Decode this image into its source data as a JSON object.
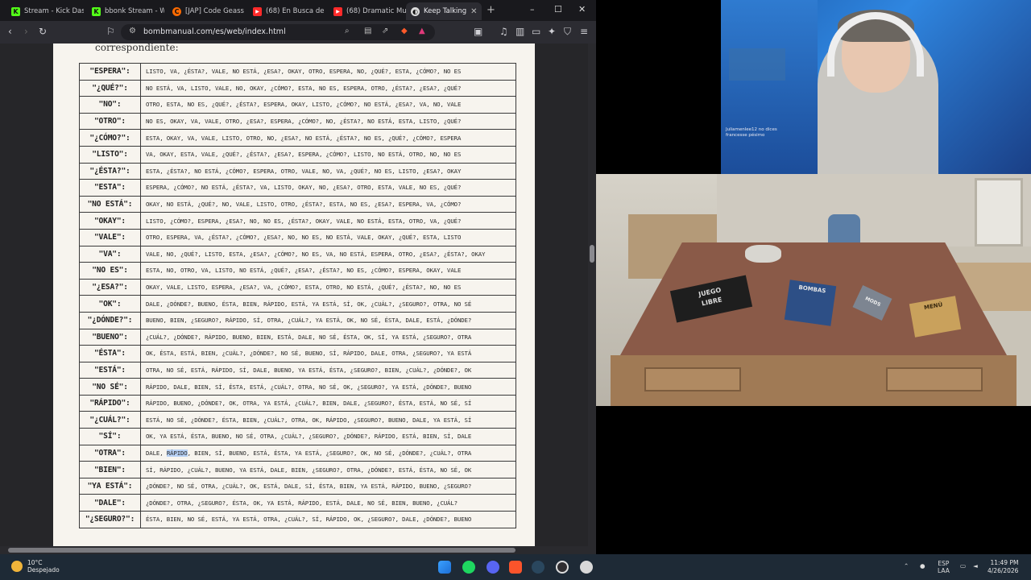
{
  "browser": {
    "tabs": [
      {
        "title": "Stream - Kick Dash",
        "icon_color": "#53fc18",
        "icon": "K"
      },
      {
        "title": "bbonk Stream - W",
        "icon_color": "#53fc18",
        "icon": "K"
      },
      {
        "title": "[JAP] Code Geass",
        "icon_color": "#ff6a00",
        "icon": "C"
      },
      {
        "title": "(68) En Busca de l",
        "icon_color": "#ff2a2a",
        "icon": "▶"
      },
      {
        "title": "(68) Dramatic Mu",
        "icon_color": "#ff2a2a",
        "icon": "▶"
      },
      {
        "title": "Keep Talking",
        "icon_color": "#dcdcdc",
        "icon": "◐"
      }
    ],
    "url": "bombmanual.com/es/web/index.html",
    "new_tab": "+",
    "window_controls": [
      "–",
      "☐",
      "✕"
    ]
  },
  "manual": {
    "intro": "correspondiente:",
    "rows": [
      {
        "key": "\"ESPERA\":",
        "list": "LISTO, VA, ¿ÉSTA?, VALE, NO ESTÁ, ¿ESA?, OKAY, OTRO, ESPERA, NO, ¿QUÉ?, ESTA, ¿CÓMO?, NO ES"
      },
      {
        "key": "\"¿QUÉ?\":",
        "list": "NO ESTÁ, VA, LISTO, VALE, NO, OKAY, ¿CÓMO?, ESTA, NO ES, ESPERA, OTRO, ¿ÉSTA?, ¿ESA?, ¿QUÉ?"
      },
      {
        "key": "\"NO\":",
        "list": "OTRO, ESTA, NO ES, ¿QUÉ?, ¿ÉSTA?, ESPERA, OKAY, LISTO, ¿CÓMO?, NO ESTÁ, ¿ESA?, VA, NO, VALE"
      },
      {
        "key": "\"OTRO\":",
        "list": "NO ES, OKAY, VA, VALE, OTRO, ¿ESA?, ESPERA, ¿CÓMO?, NO, ¿ÉSTA?, NO ESTÁ, ESTA, LISTO, ¿QUÉ?"
      },
      {
        "key": "\"¿CÓMO?\":",
        "list": "ESTA, OKAY, VA, VALE, LISTO, OTRO, NO, ¿ESA?, NO ESTÁ, ¿ÉSTA?, NO ES, ¿QUÉ?, ¿CÓMO?, ESPERA"
      },
      {
        "key": "\"LISTO\":",
        "list": "VA, OKAY, ESTA, VALE, ¿QUÉ?, ¿ÉSTA?, ¿ESA?, ESPERA, ¿CÓMO?, LISTO, NO ESTÁ, OTRO, NO, NO ES"
      },
      {
        "key": "\"¿ÉSTA?\":",
        "list": "ESTA, ¿ÉSTA?, NO ESTÁ, ¿CÓMO?, ESPERA, OTRO, VALE, NO, VA, ¿QUÉ?, NO ES, LISTO, ¿ESA?, OKAY"
      },
      {
        "key": "\"ESTA\":",
        "list": "ESPERA, ¿CÓMO?, NO ESTÁ, ¿ÉSTA?, VA, LISTO, OKAY, NO, ¿ESA?, OTRO, ESTA, VALE, NO ES, ¿QUÉ?"
      },
      {
        "key": "\"NO ESTÁ\":",
        "list": "OKAY, NO ESTÁ, ¿QUÉ?, NO, VALE, LISTO, OTRO, ¿ÉSTA?, ESTA, NO ES, ¿ESA?, ESPERA, VA, ¿CÓMO?"
      },
      {
        "key": "\"OKAY\":",
        "list": "LISTO, ¿CÓMO?, ESPERA, ¿ESA?, NO, NO ES, ¿ÉSTA?, OKAY, VALE, NO ESTÁ, ESTA, OTRO, VA, ¿QUÉ?"
      },
      {
        "key": "\"VALE\":",
        "list": "OTRO, ESPERA, VA, ¿ÉSTA?, ¿CÓMO?, ¿ESA?, NO, NO ES, NO ESTÁ, VALE, OKAY, ¿QUÉ?, ESTA, LISTO"
      },
      {
        "key": "\"VA\":",
        "list": "VALE, NO, ¿QUÉ?, LISTO, ESTA, ¿ESA?, ¿CÓMO?, NO ES, VA, NO ESTÁ, ESPERA, OTRO, ¿ESA?, ¿ÉSTA?, OKAY"
      },
      {
        "key": "\"NO ES\":",
        "list": "ESTA, NO, OTRO, VA, LISTO, NO ESTÁ, ¿QUÉ?, ¿ESA?, ¿ÉSTA?, NO ES, ¿CÓMO?, ESPERA, OKAY, VALE"
      },
      {
        "key": "\"¿ESA?\":",
        "list": "OKAY, VALE, LISTO, ESPERA, ¿ESA?, VA, ¿CÓMO?, ESTA, OTRO, NO ESTÁ, ¿QUÉ?, ¿ÉSTA?, NO, NO ES"
      },
      {
        "key": "\"OK\":",
        "list": "DALE, ¿DÓNDE?, BUENO, ÉSTA, BIEN, RÁPIDO, ESTÁ, YA ESTÁ, SÍ, OK, ¿CUÁL?, ¿SEGURO?, OTRA, NO SÉ"
      },
      {
        "key": "\"¿DÓNDE?\":",
        "list": "BUENO, BIEN, ¿SEGURO?, RÁPIDO, SÍ, OTRA, ¿CUÁL?, YA ESTÁ, OK, NO SÉ, ÉSTA, DALE, ESTÁ, ¿DÓNDE?"
      },
      {
        "key": "\"BUENO\":",
        "list": "¿CUÁL?, ¿DÓNDE?, RÁPIDO, BUENO, BIEN, ESTÁ, DALE, NO SÉ, ÉSTA, OK, SÍ, YA ESTÁ, ¿SEGURO?, OTRA"
      },
      {
        "key": "\"ÉSTA\":",
        "list": "OK, ÉSTA, ESTÁ, BIEN, ¿CUÁL?, ¿DÓNDE?, NO SÉ, BUENO, SÍ, RÁPIDO, DALE, OTRA, ¿SEGURO?, YA ESTÁ"
      },
      {
        "key": "\"ESTÁ\":",
        "list": "OTRA, NO SÉ, ESTÁ, RÁPIDO, SÍ, DALE, BUENO, YA ESTÁ, ÉSTA, ¿SEGURO?, BIEN, ¿CUÁL?, ¿DÓNDE?, OK"
      },
      {
        "key": "\"NO SÉ\":",
        "list": "RÁPIDO, DALE, BIEN, SÍ, ÉSTA, ESTÁ, ¿CUÁL?, OTRA, NO SÉ, OK, ¿SEGURO?, YA ESTÁ, ¿DÓNDE?, BUENO"
      },
      {
        "key": "\"RÁPIDO\":",
        "list": "RÁPIDO, BUENO, ¿DÓNDE?, OK, OTRA, YA ESTÁ, ¿CUÁL?, BIEN, DALE, ¿SEGURO?, ÉSTA, ESTÁ, NO SÉ, SÍ"
      },
      {
        "key": "\"¿CUÁL?\":",
        "list": "ESTÁ, NO SÉ, ¿DÓNDE?, ÉSTA, BIEN, ¿CUÁL?, OTRA, OK, RÁPIDO, ¿SEGURO?, BUENO, DALE, YA ESTÁ, SÍ"
      },
      {
        "key": "\"SÍ\":",
        "list": "OK, YA ESTÁ, ÉSTA, BUENO, NO SÉ, OTRA, ¿CUÁL?, ¿SEGURO?, ¿DÓNDE?, RÁPIDO, ESTÁ, BIEN, SÍ, DALE"
      },
      {
        "key": "\"OTRA\":",
        "list_before": "DALE, ",
        "list_highlight": "RÁPIDO",
        "list_after": ", BIEN, SÍ, BUENO, ESTÁ, ÉSTA, YA ESTÁ, ¿SEGURO?, OK, NO SÉ, ¿DÓNDE?, ¿CUÁL?, OTRA"
      },
      {
        "key": "\"BIEN\":",
        "list": "SÍ, RÁPIDO, ¿CUÁL?, BUENO, YA ESTÁ, DALE, BIEN, ¿SEGURO?, OTRA, ¿DÓNDE?, ESTÁ, ÉSTA, NO SÉ, OK"
      },
      {
        "key": "\"YA ESTÁ\":",
        "list": "¿DÓNDE?, NO SÉ, OTRA, ¿CUÁL?, OK, ESTÁ, DALE, SÍ, ÉSTA, BIEN, YA ESTÁ, RÁPIDO, BUENO, ¿SEGURO?"
      },
      {
        "key": "\"DALE\":",
        "list": "¿DÓNDE?, OTRA, ¿SEGURO?, ÉSTA, OK, YA ESTÁ, RÁPIDO, ESTÁ, DALE, NO SÉ, BIEN, BUENO, ¿CUÁL?"
      },
      {
        "key": "\"¿SEGURO?\":",
        "list": "ÉSTA, BIEN, NO SÉ, ESTÁ, YA ESTÁ, OTRA, ¿CUÁL?, SÍ, RÁPIDO, OK, ¿SEGURO?, DALE, ¿DÓNDE?, BUENO"
      }
    ]
  },
  "webcam": {
    "caption_line1": "Juliamenlee12 no dices",
    "caption_line2": "francesse pésimo"
  },
  "game": {
    "booklet_label_1": "JUEGO",
    "booklet_label_2": "LIBRE",
    "bombs_label": "BOMBAS",
    "mods_label": "MODS",
    "menu_label": "MENÚ"
  },
  "taskbar": {
    "temperature": "10°C",
    "weather": "Despejado",
    "language_1": "ESP",
    "language_2": "LAA",
    "time": "11:49 PM",
    "date": "4/26/2026"
  }
}
